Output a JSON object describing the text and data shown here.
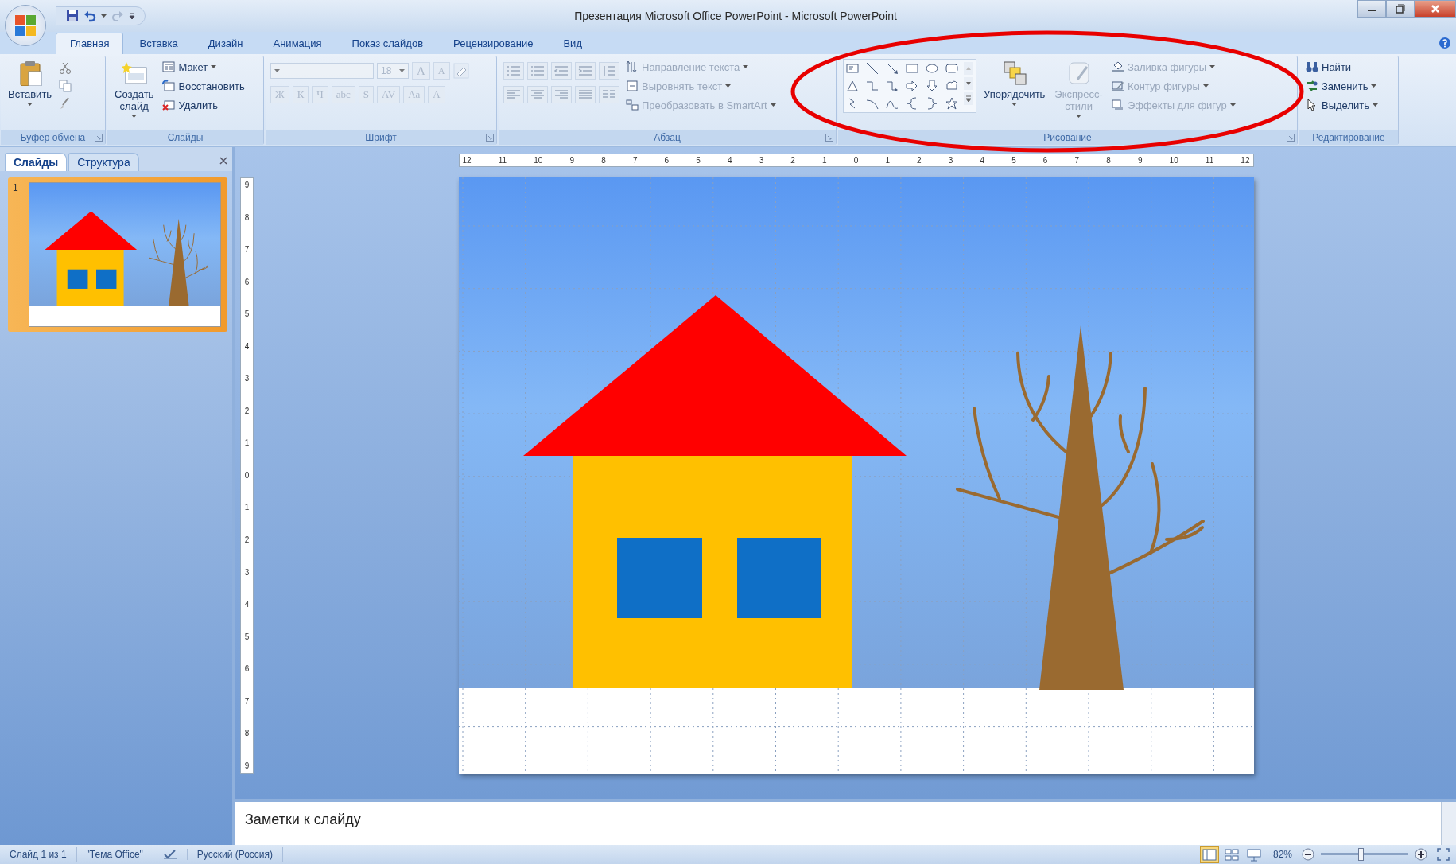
{
  "window": {
    "title": "Презентация Microsoft Office PowerPoint - Microsoft PowerPoint"
  },
  "tabs": [
    {
      "label": "Главная",
      "selected": true
    },
    {
      "label": "Вставка",
      "selected": false
    },
    {
      "label": "Дизайн",
      "selected": false
    },
    {
      "label": "Анимация",
      "selected": false
    },
    {
      "label": "Показ слайдов",
      "selected": false
    },
    {
      "label": "Рецензирование",
      "selected": false
    },
    {
      "label": "Вид",
      "selected": false
    }
  ],
  "ribbon": {
    "groups": [
      {
        "label": "Буфер обмена",
        "launcher": true,
        "items": [
          {
            "kind": "large",
            "label": "Вставить",
            "dropdown": true,
            "disabled": false
          },
          {
            "kind": "clipboard",
            "disabled": false
          }
        ]
      },
      {
        "label": "Слайды",
        "launcher": false,
        "items": [
          {
            "kind": "large",
            "label": "Создать слайд",
            "dropdown": true,
            "disabled": false
          },
          {
            "kind": "stack",
            "rows": [
              {
                "label": "Макет",
                "dropdown": true,
                "disabled": false
              },
              {
                "label": "Восстановить",
                "dropdown": false,
                "disabled": false
              },
              {
                "label": "Удалить",
                "dropdown": false,
                "disabled": false
              }
            ]
          }
        ]
      },
      {
        "label": "Шрифт",
        "launcher": true,
        "items": [
          {
            "kind": "font",
            "font_size": "18",
            "grow_shrink": [
              "A",
              "A"
            ],
            "format_buttons": [
              "Ж",
              "К",
              "Ч",
              "abc",
              "S",
              "AV",
              "Aa",
              "A"
            ],
            "disabled": true
          }
        ]
      },
      {
        "label": "Абзац",
        "launcher": true,
        "items": [
          {
            "kind": "paragraph",
            "disabled": true
          },
          {
            "kind": "stack",
            "rows": [
              {
                "label": "Направление текста",
                "dropdown": true,
                "disabled": true
              },
              {
                "label": "Выровнять текст",
                "dropdown": true,
                "disabled": true
              },
              {
                "label": "Преобразовать в SmartArt",
                "dropdown": true,
                "disabled": true
              }
            ]
          }
        ]
      },
      {
        "label": "Рисование",
        "launcher": true,
        "items": [
          {
            "kind": "gallery",
            "disabled": false
          },
          {
            "kind": "large",
            "label": "Упорядочить",
            "dropdown": true,
            "disabled": false
          },
          {
            "kind": "large",
            "label": "Экспресс-стили",
            "dropdown": true,
            "disabled": true
          },
          {
            "kind": "stack",
            "rows": [
              {
                "label": "Заливка фигуры",
                "dropdown": true,
                "disabled": true
              },
              {
                "label": "Контур фигуры",
                "dropdown": true,
                "disabled": true
              },
              {
                "label": "Эффекты для фигур",
                "dropdown": true,
                "disabled": true
              }
            ]
          }
        ]
      },
      {
        "label": "Редактирование",
        "launcher": false,
        "items": [
          {
            "kind": "stack",
            "rows": [
              {
                "label": "Найти",
                "dropdown": false,
                "disabled": false
              },
              {
                "label": "Заменить",
                "dropdown": true,
                "disabled": false
              },
              {
                "label": "Выделить",
                "dropdown": true,
                "disabled": false
              }
            ]
          }
        ]
      }
    ]
  },
  "slides_pane": {
    "tabs": [
      {
        "label": "Слайды",
        "selected": true
      },
      {
        "label": "Структура",
        "selected": false
      }
    ],
    "thumbnails": [
      {
        "number": "1",
        "selected": true
      }
    ]
  },
  "ruler": {
    "horizontal": [
      "12",
      "11",
      "10",
      "9",
      "8",
      "7",
      "6",
      "5",
      "4",
      "3",
      "2",
      "1",
      "0",
      "1",
      "2",
      "3",
      "4",
      "5",
      "6",
      "7",
      "8",
      "9",
      "10",
      "11",
      "12"
    ],
    "vertical": [
      "9",
      "8",
      "7",
      "6",
      "5",
      "4",
      "3",
      "2",
      "1",
      "0",
      "1",
      "2",
      "3",
      "4",
      "5",
      "6",
      "7",
      "8",
      "9"
    ]
  },
  "notes": {
    "placeholder": "Заметки к слайду"
  },
  "status_bar": {
    "slide_info": "Слайд 1 из 1",
    "theme": "\"Тема Office\"",
    "language": "Русский (Россия)",
    "views": [
      {
        "selected": true
      },
      {
        "selected": false
      },
      {
        "selected": false
      }
    ],
    "zoom": "82%",
    "zoom_slider": {
      "level": 0.45
    }
  }
}
